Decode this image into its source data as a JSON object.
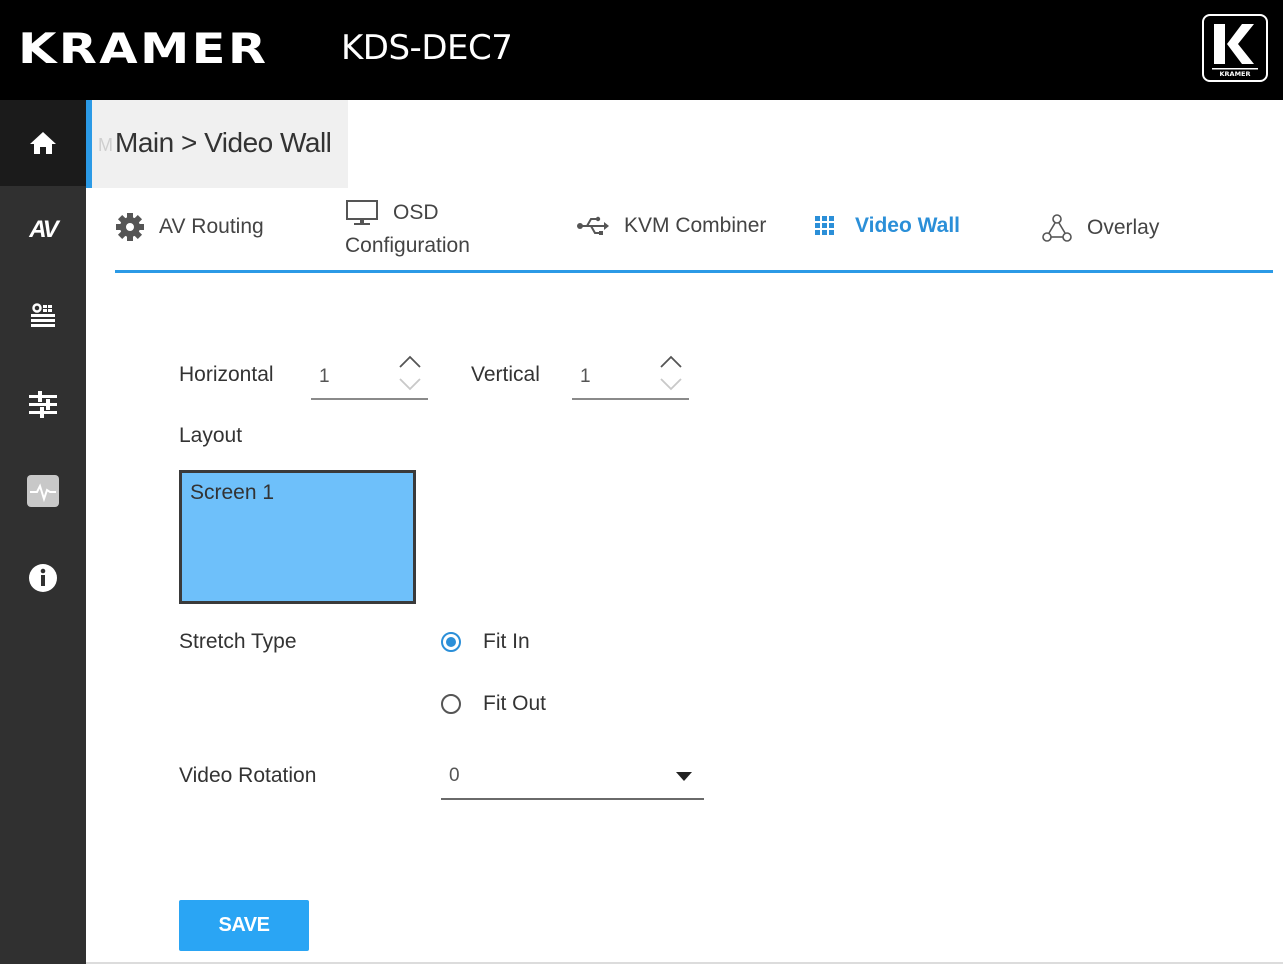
{
  "header": {
    "brand": "KRAMER",
    "device_name": "KDS-DEC7",
    "logo_caption": "KRAMER"
  },
  "sidebar": {
    "items": [
      {
        "icon": "home-icon"
      },
      {
        "label": "AV"
      },
      {
        "icon": "settings-list-icon"
      },
      {
        "icon": "sliders-icon"
      },
      {
        "icon": "diagnostics-icon"
      },
      {
        "icon": "info-icon"
      }
    ]
  },
  "breadcrumb": {
    "ghost": "M",
    "path": "Main > Video Wall"
  },
  "tabs": [
    {
      "label": "AV Routing",
      "icon": "gear-icon"
    },
    {
      "label_line1": "OSD",
      "label_line2": "Configuration",
      "icon": "monitor-icon"
    },
    {
      "label": "KVM Combiner",
      "icon": "usb-icon"
    },
    {
      "label": "Video Wall",
      "icon": "grid-icon",
      "active": true
    },
    {
      "label": "Overlay",
      "icon": "overlay-icon"
    }
  ],
  "form": {
    "horizontal_label": "Horizontal",
    "horizontal_value": "1",
    "vertical_label": "Vertical",
    "vertical_value": "1",
    "layout_label": "Layout",
    "screen_label": "Screen 1",
    "stretch_label": "Stretch Type",
    "stretch_options": [
      "Fit In",
      "Fit Out"
    ],
    "stretch_selected": "Fit In",
    "rotation_label": "Video Rotation",
    "rotation_value": "0",
    "save_label": "SAVE"
  },
  "colors": {
    "accent": "#2b9ae6",
    "active_tab": "#2b8fd8",
    "layout_fill": "#6ec0fa",
    "save_button": "#2aa5f4",
    "sidebar": "#303030",
    "header": "#000000"
  }
}
